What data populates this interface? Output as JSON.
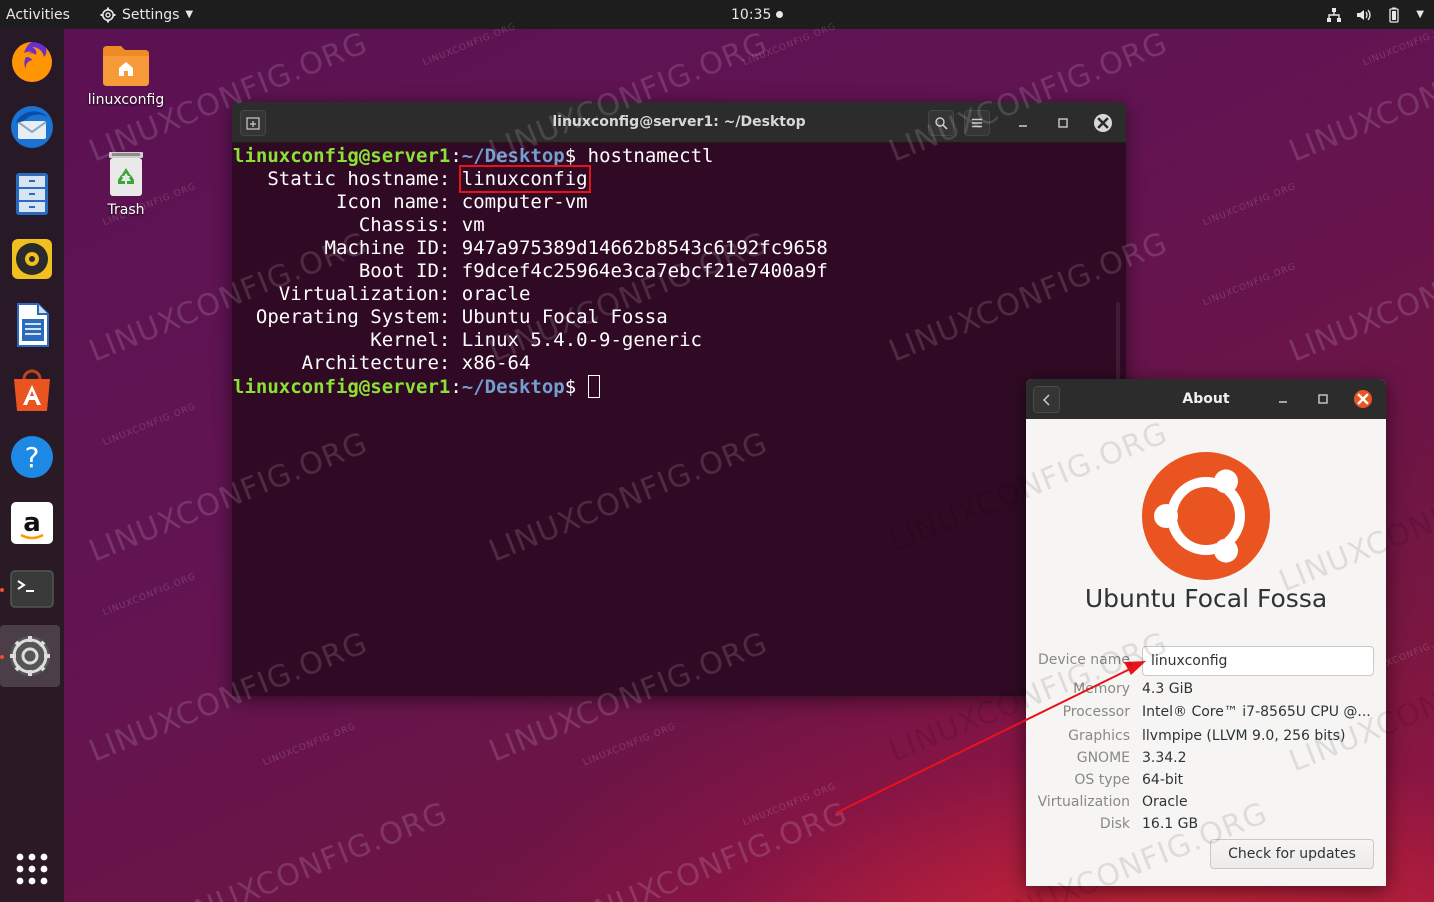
{
  "topbar": {
    "activities": "Activities",
    "app_menu": "Settings",
    "clock": "10:35"
  },
  "dock": {
    "items": [
      "firefox-icon",
      "thunderbird-icon",
      "files-icon",
      "rhythmbox-icon",
      "libreoffice-writer-icon",
      "software-icon",
      "help-icon",
      "amazon-icon",
      "terminal-icon",
      "settings-icon",
      "show-apps-icon"
    ]
  },
  "desktop": {
    "home_label": "linuxconfig",
    "trash_label": "Trash"
  },
  "terminal": {
    "title": "linuxconfig@server1: ~/Desktop",
    "prompt_user": "linuxconfig@server1",
    "prompt_sep": ":",
    "prompt_path": "~/Desktop",
    "prompt_end": "$ ",
    "command": "hostnamectl",
    "lines": [
      {
        "label": "   Static hostname: ",
        "value": "linuxconfig"
      },
      {
        "label": "         Icon name: ",
        "value": "computer-vm"
      },
      {
        "label": "           Chassis: ",
        "value": "vm"
      },
      {
        "label": "        Machine ID: ",
        "value": "947a975389d14662b8543c6192fc9658"
      },
      {
        "label": "           Boot ID: ",
        "value": "f9dcef4c25964e3ca7ebcf21e7400a9f"
      },
      {
        "label": "    Virtualization: ",
        "value": "oracle"
      },
      {
        "label": "  Operating System: ",
        "value": "Ubuntu Focal Fossa"
      },
      {
        "label": "            Kernel: ",
        "value": "Linux 5.4.0-9-generic"
      },
      {
        "label": "      Architecture: ",
        "value": "x86-64"
      }
    ]
  },
  "about": {
    "title": "About",
    "os_name": "Ubuntu Focal Fossa",
    "device_name_label": "Device name",
    "device_name_value": "linuxconfig",
    "rows": [
      {
        "label": "Memory",
        "value": "4.3 GiB"
      },
      {
        "label": "Processor",
        "value": "Intel® Core™ i7-8565U CPU @..."
      },
      {
        "label": "Graphics",
        "value": "llvmpipe (LLVM 9.0, 256 bits)"
      },
      {
        "label": "GNOME",
        "value": "3.34.2"
      },
      {
        "label": "OS type",
        "value": "64-bit"
      },
      {
        "label": "Virtualization",
        "value": "Oracle"
      },
      {
        "label": "Disk",
        "value": "16.1 GB"
      }
    ],
    "update_button": "Check for updates"
  },
  "watermark": {
    "large": "LINUXCONFIG.ORG",
    "small": "LINUXCONFIG.ORG"
  },
  "colors": {
    "accent": "#e95420",
    "prompt_user": "#8ae234",
    "prompt_path": "#729fcf",
    "terminal_bg": "#300a24",
    "highlight": "#e8121a"
  }
}
